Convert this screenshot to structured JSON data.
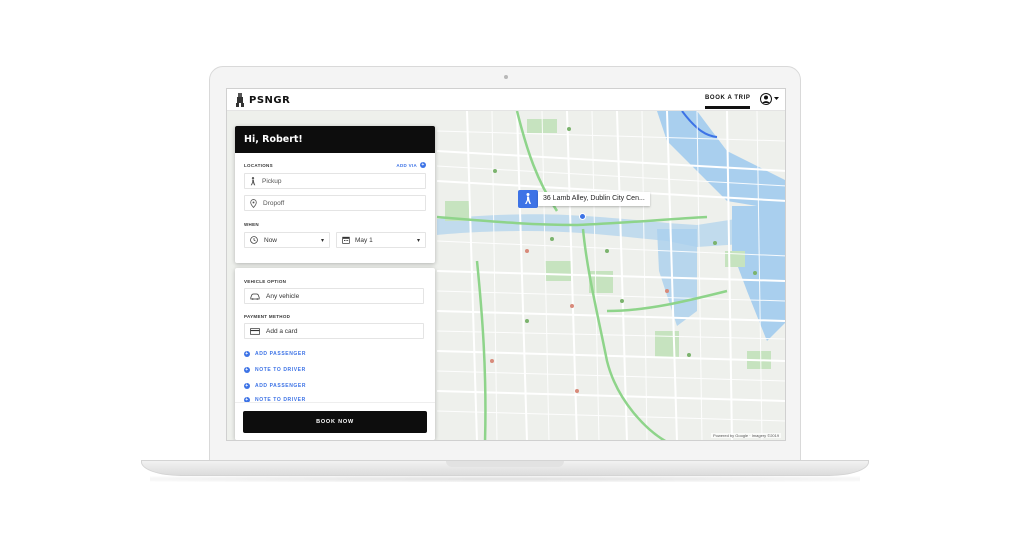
{
  "app": {
    "logo_text": "PSNGR"
  },
  "nav": {
    "book_trip": "BOOK A TRIP",
    "avatar_icon": "user-circle-icon"
  },
  "booking": {
    "greeting": "Hi, Robert!",
    "locations_label": "LOCATIONS",
    "add_via_label": "ADD VIA",
    "pickup_placeholder": "Pickup",
    "dropoff_placeholder": "Dropoff",
    "when_label": "WHEN",
    "time_value": "Now",
    "date_value": "May 1",
    "vehicle_label": "VEHICLE OPTION",
    "vehicle_value": "Any vehicle",
    "payment_label": "PAYMENT METHOD",
    "payment_value": "Add a card",
    "links": [
      "ADD PASSENGER",
      "NOTE TO DRIVER",
      "ADD PASSENGER",
      "NOTE TO DRIVER"
    ],
    "book_button": "BOOK NOW"
  },
  "map": {
    "marker_label": "36 Lamb Alley, Dublin City Cen...",
    "attribution": "Powered by Google · Imagery ©2019",
    "accent_color": "#3d73e6"
  }
}
